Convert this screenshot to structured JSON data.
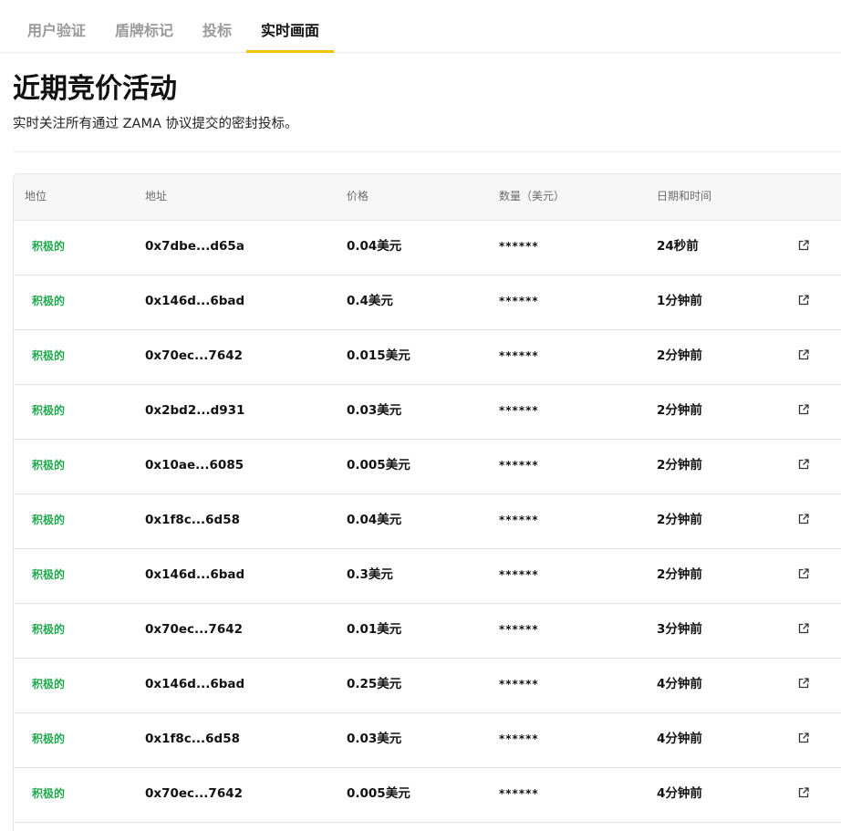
{
  "tabs": [
    {
      "label": "用户验证",
      "active": false
    },
    {
      "label": "盾牌标记",
      "active": false
    },
    {
      "label": "投标",
      "active": false
    },
    {
      "label": "实时画面",
      "active": true
    }
  ],
  "page": {
    "title": "近期竞价活动",
    "subtitle": "实时关注所有通过 ZAMA 协议提交的密封投标。"
  },
  "table": {
    "columns": [
      "地位",
      "地址",
      "价格",
      "数量（美元）",
      "日期和时间"
    ],
    "rows": [
      {
        "status": "积极的",
        "address": "0x7dbe...d65a",
        "price": "0.04美元",
        "quantity": "******",
        "time": "24秒前",
        "icon": "external-link-icon"
      },
      {
        "status": "积极的",
        "address": "0x146d...6bad",
        "price": "0.4美元",
        "quantity": "******",
        "time": "1分钟前",
        "icon": "external-link-icon"
      },
      {
        "status": "积极的",
        "address": "0x70ec...7642",
        "price": "0.015美元",
        "quantity": "******",
        "time": "2分钟前",
        "icon": "external-link-icon"
      },
      {
        "status": "积极的",
        "address": "0x2bd2...d931",
        "price": "0.03美元",
        "quantity": "******",
        "time": "2分钟前",
        "icon": "external-link-icon"
      },
      {
        "status": "积极的",
        "address": "0x10ae...6085",
        "price": "0.005美元",
        "quantity": "******",
        "time": "2分钟前",
        "icon": "external-link-icon"
      },
      {
        "status": "积极的",
        "address": "0x1f8c...6d58",
        "price": "0.04美元",
        "quantity": "******",
        "time": "2分钟前",
        "icon": "external-link-icon"
      },
      {
        "status": "积极的",
        "address": "0x146d...6bad",
        "price": "0.3美元",
        "quantity": "******",
        "time": "2分钟前",
        "icon": "external-link-icon"
      },
      {
        "status": "积极的",
        "address": "0x70ec...7642",
        "price": "0.01美元",
        "quantity": "******",
        "time": "3分钟前",
        "icon": "external-link-icon"
      },
      {
        "status": "积极的",
        "address": "0x146d...6bad",
        "price": "0.25美元",
        "quantity": "******",
        "time": "4分钟前",
        "icon": "external-link-icon"
      },
      {
        "status": "积极的",
        "address": "0x1f8c...6d58",
        "price": "0.03美元",
        "quantity": "******",
        "time": "4分钟前",
        "icon": "external-link-icon"
      },
      {
        "status": "积极的",
        "address": "0x70ec...7642",
        "price": "0.005美元",
        "quantity": "******",
        "time": "4分钟前",
        "icon": "external-link-icon"
      }
    ]
  },
  "colors": {
    "accent": "#f2c200",
    "status_active": "#1faa4b",
    "muted_text": "#9a9a9a",
    "border": "#e4e4e4"
  }
}
